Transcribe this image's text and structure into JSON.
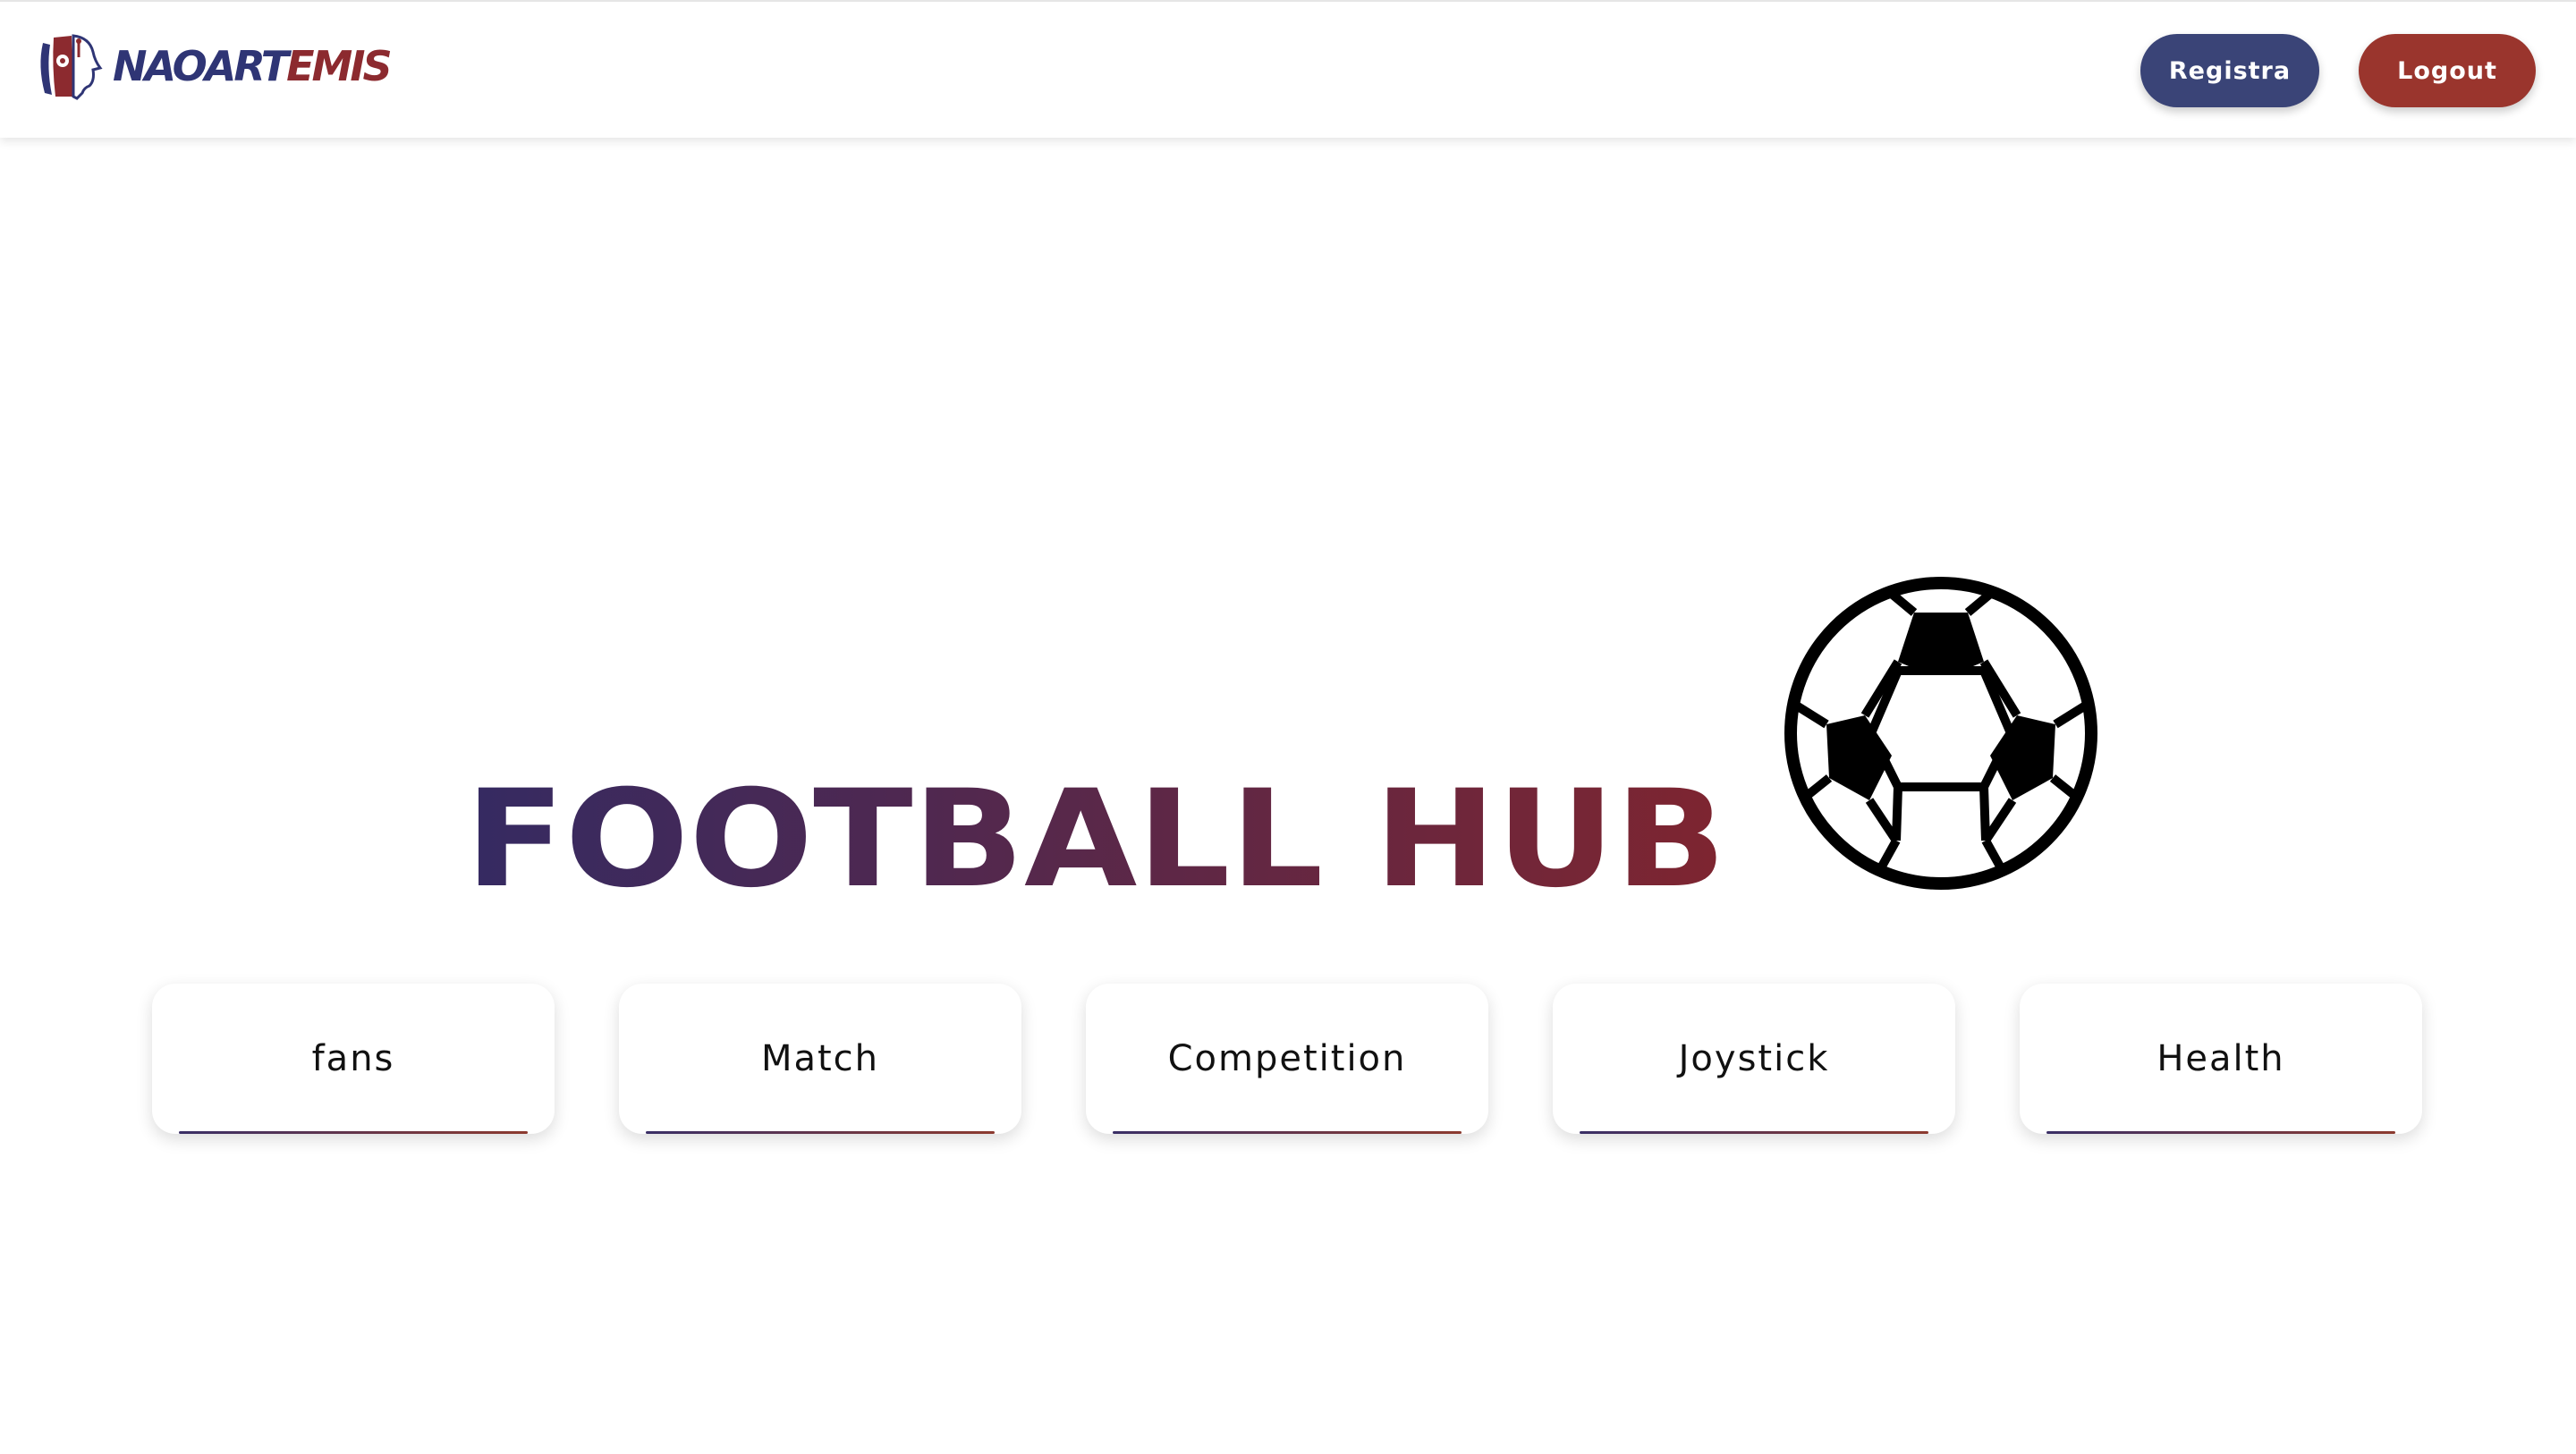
{
  "header": {
    "logo": {
      "text_a": "NAOART",
      "text_b": "EMIS",
      "icon": "robot-head-icon",
      "color_a": "#2f3575",
      "color_b": "#8c2a2f"
    },
    "register_label": "Registra",
    "logout_label": "Logout",
    "register_color": "#3a4477",
    "logout_color": "#9a352d"
  },
  "hero": {
    "title": "FOOTBALL HUB",
    "icon": "soccer-ball-icon",
    "gradient_start": "#352a62",
    "gradient_end": "#7e2530"
  },
  "cards": [
    {
      "label": "fans"
    },
    {
      "label": "Match"
    },
    {
      "label": "Competition"
    },
    {
      "label": "Joystick"
    },
    {
      "label": "Health"
    }
  ]
}
